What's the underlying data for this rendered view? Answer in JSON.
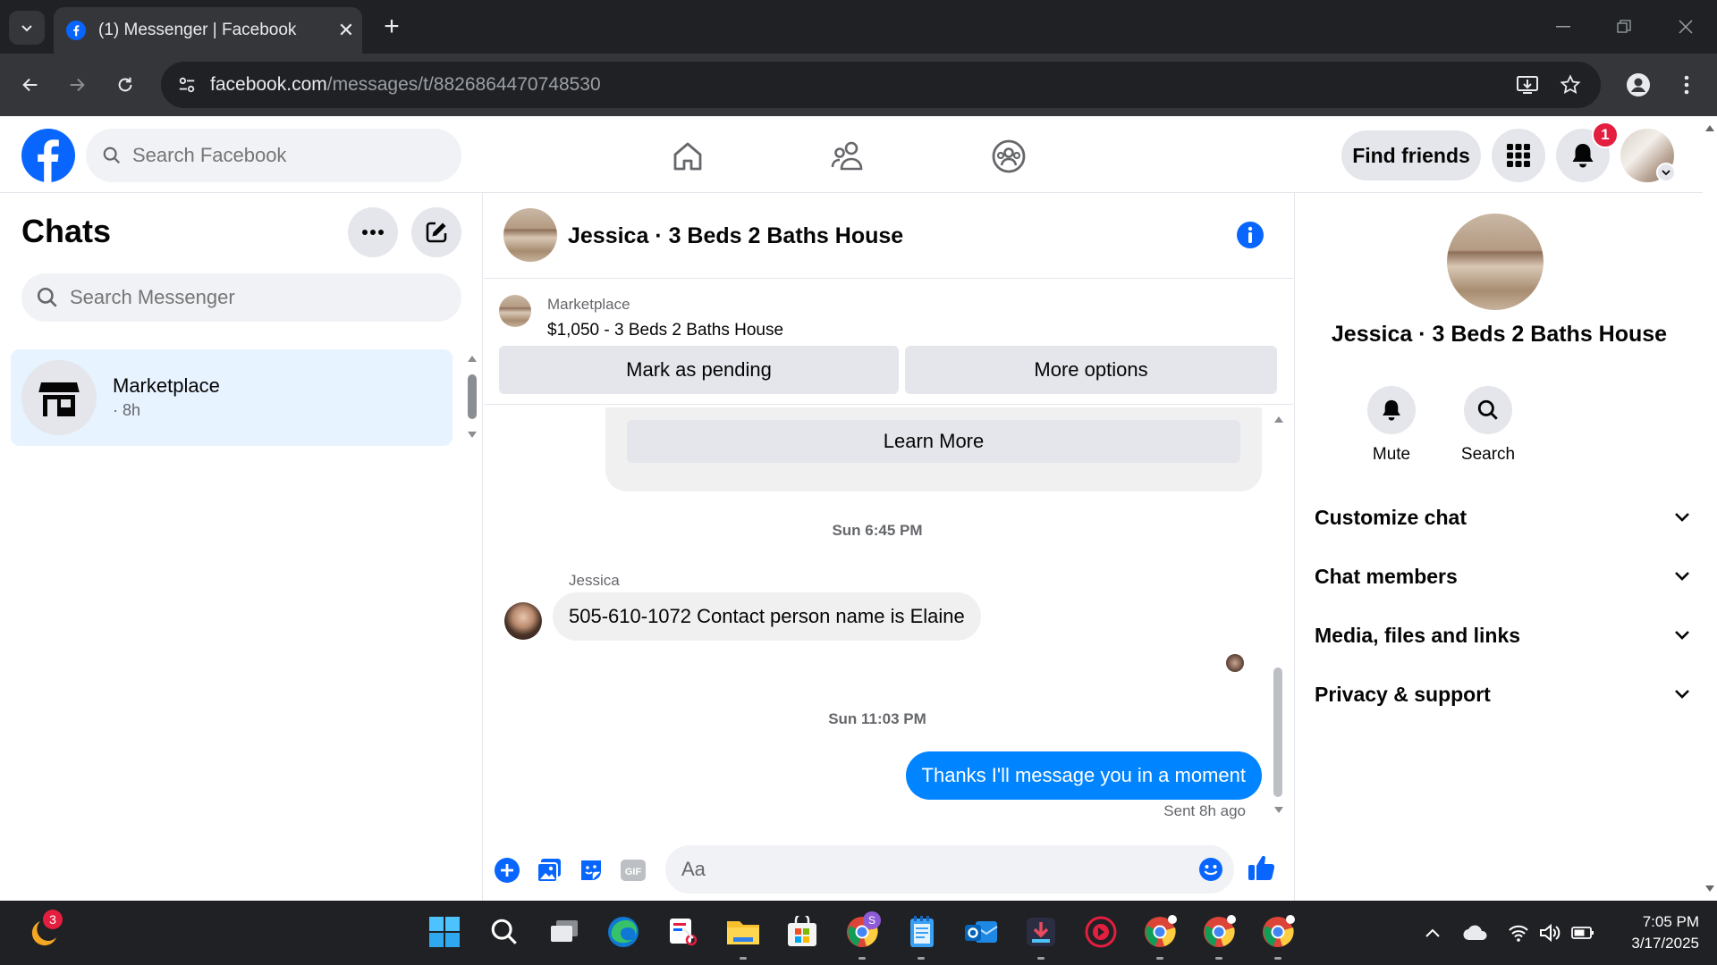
{
  "browser": {
    "tab_title": "(1) Messenger | Facebook",
    "url_host": "facebook.com",
    "url_path": "/messages/t/8826864470748530"
  },
  "fb_header": {
    "search_placeholder": "Search Facebook",
    "find_friends_label": "Find friends",
    "notification_count": "1"
  },
  "chats": {
    "title": "Chats",
    "search_placeholder": "Search Messenger",
    "items": [
      {
        "name": "Marketplace",
        "time": "· 8h"
      }
    ]
  },
  "conversation": {
    "title": "Jessica · 3 Beds 2 Baths House",
    "marketplace_label": "Marketplace",
    "listing": "$1,050 - 3 Beds 2 Baths House",
    "mark_pending_label": "Mark as pending",
    "more_options_label": "More options",
    "learn_more_label": "Learn More",
    "messages": [
      {
        "timestamp": "Sun 6:45 PM",
        "sender": "Jessica",
        "text": "505-610-1072 Contact person name is Elaine"
      },
      {
        "timestamp": "Sun 11:03 PM",
        "text": "Thanks I'll message you in a moment",
        "status": "Sent 8h ago"
      }
    ],
    "composer_placeholder": "Aa"
  },
  "info_panel": {
    "name": "Jessica · 3 Beds 2 Baths House",
    "actions": [
      {
        "label": "Mute"
      },
      {
        "label": "Search"
      }
    ],
    "sections": [
      {
        "label": "Customize chat"
      },
      {
        "label": "Chat members"
      },
      {
        "label": "Media, files and links"
      },
      {
        "label": "Privacy & support"
      }
    ]
  },
  "taskbar": {
    "time": "7:05 PM",
    "date": "3/17/2025",
    "weather_badge": "3",
    "chrome_profile_letter": "S"
  },
  "colors": {
    "facebook_blue": "#0866ff",
    "messenger_blue": "#0084ff",
    "selected_chat_bg": "#e7f3ff",
    "badge_red": "#e41e3f"
  }
}
